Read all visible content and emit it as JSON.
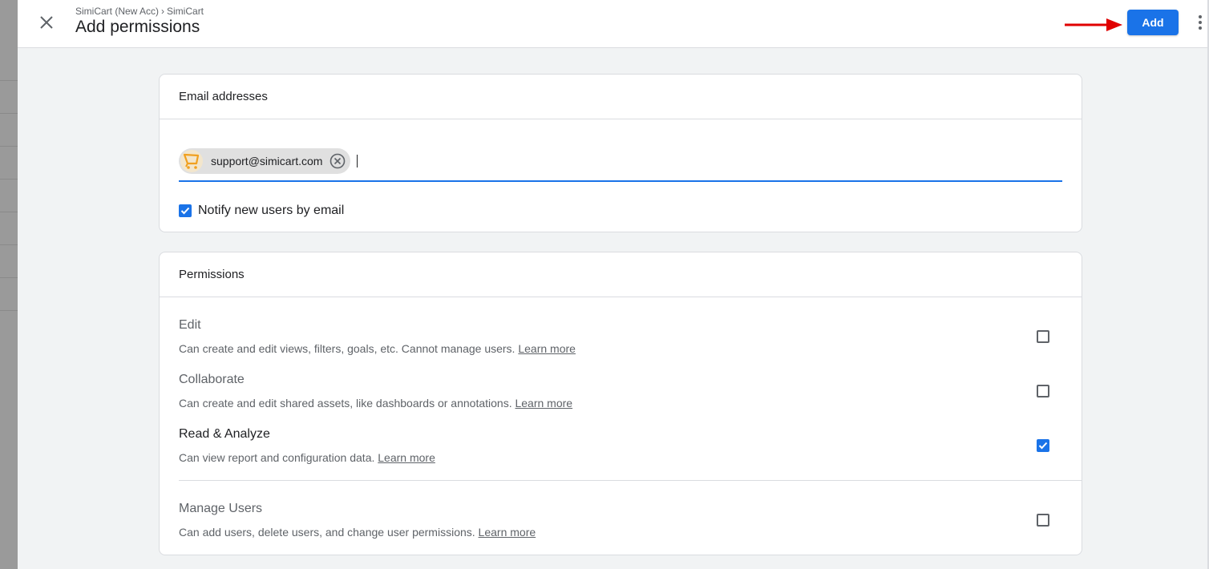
{
  "header": {
    "breadcrumb": [
      "SimiCart (New Acc)",
      "SimiCart"
    ],
    "breadcrumb_separator": "›",
    "title": "Add permissions",
    "add_label": "Add",
    "accent_color": "#1a73e8",
    "arrow_color": "#e00000"
  },
  "email_card": {
    "heading": "Email addresses",
    "chip_email": "support@simicart.com",
    "notify_label": "Notify new users by email",
    "notify_checked": true
  },
  "permissions_card": {
    "heading": "Permissions",
    "items": [
      {
        "name": "Edit",
        "description": "Can create and edit views, filters, goals, etc. Cannot manage users.",
        "link": "Learn more",
        "checked": false
      },
      {
        "name": "Collaborate",
        "description": "Can create and edit shared assets, like dashboards or annotations.",
        "link": "Learn more",
        "checked": false
      },
      {
        "name": "Read & Analyze",
        "description": "Can view report and configuration data.",
        "link": "Learn more",
        "checked": true
      },
      {
        "name": "Manage Users",
        "description": "Can add users, delete users, and change user permissions.",
        "link": "Learn more",
        "checked": false
      }
    ]
  }
}
